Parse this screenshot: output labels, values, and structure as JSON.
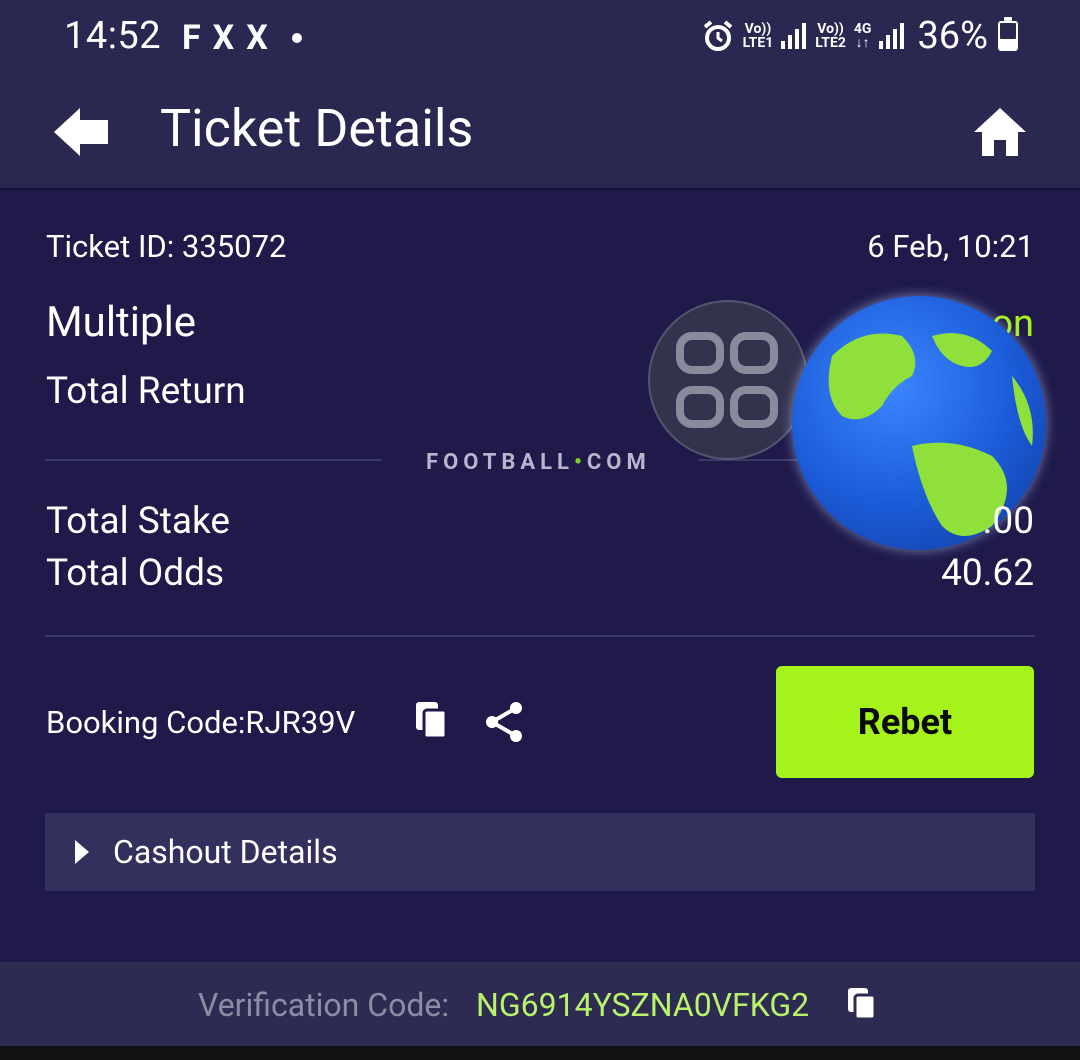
{
  "status_bar": {
    "time": "14:52",
    "left_icons": [
      "F",
      "X",
      "X"
    ],
    "sim1_label": "Vo))",
    "sim1_sub": "LTE1",
    "sim2_label": "Vo))",
    "sim2_sub": "LTE2",
    "network_type": "4G",
    "battery": "36%"
  },
  "header": {
    "title": "Ticket Details"
  },
  "ticket": {
    "id_label": "Ticket ID: 335072",
    "date": "6 Feb, 10:21",
    "type": "Multiple",
    "status": "on",
    "total_return_label": "Total Return",
    "total_stake_label": "Total Stake",
    "total_stake_value": ".00",
    "total_odds_label": "Total Odds",
    "total_odds_value": "40.62"
  },
  "watermark": {
    "text_pre": "FOOTBALL",
    "dot": "•",
    "text_post": "COM"
  },
  "booking": {
    "label": "Booking Code:RJR39V",
    "rebet_label": "Rebet"
  },
  "cashout": {
    "label": "Cashout Details"
  },
  "footer": {
    "verification_label": "Verification Code:",
    "verification_code": "NG6914YSZNA0VFKG2"
  },
  "colors": {
    "background": "#1f1a4a",
    "header": "#2a2750",
    "accent_green": "#a5f31b",
    "code_green": "#b9f26b"
  }
}
